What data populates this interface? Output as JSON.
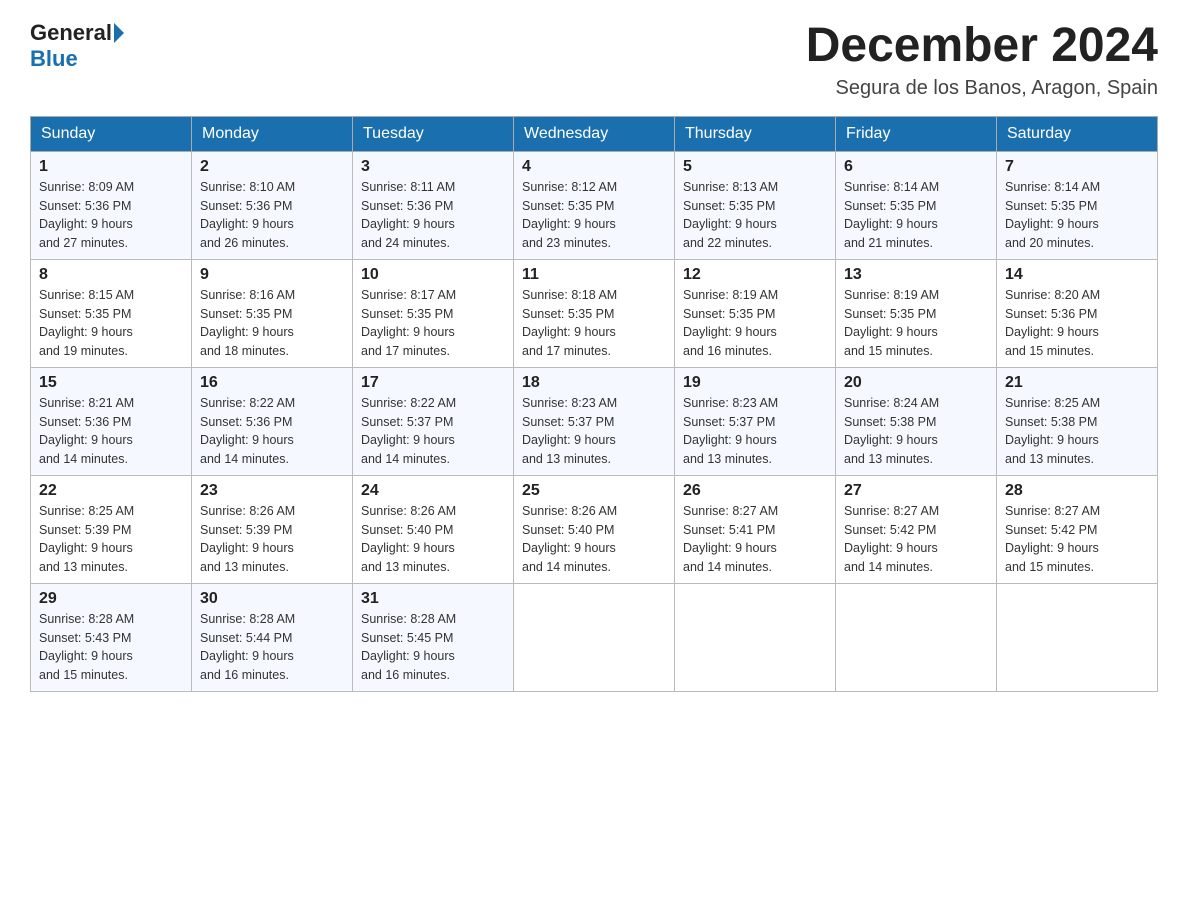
{
  "logo": {
    "text_general": "General",
    "text_blue": "Blue"
  },
  "title": {
    "month": "December 2024",
    "location": "Segura de los Banos, Aragon, Spain"
  },
  "days_of_week": [
    "Sunday",
    "Monday",
    "Tuesday",
    "Wednesday",
    "Thursday",
    "Friday",
    "Saturday"
  ],
  "weeks": [
    [
      {
        "day": "1",
        "sunrise": "8:09 AM",
        "sunset": "5:36 PM",
        "daylight": "9 hours and 27 minutes."
      },
      {
        "day": "2",
        "sunrise": "8:10 AM",
        "sunset": "5:36 PM",
        "daylight": "9 hours and 26 minutes."
      },
      {
        "day": "3",
        "sunrise": "8:11 AM",
        "sunset": "5:36 PM",
        "daylight": "9 hours and 24 minutes."
      },
      {
        "day": "4",
        "sunrise": "8:12 AM",
        "sunset": "5:35 PM",
        "daylight": "9 hours and 23 minutes."
      },
      {
        "day": "5",
        "sunrise": "8:13 AM",
        "sunset": "5:35 PM",
        "daylight": "9 hours and 22 minutes."
      },
      {
        "day": "6",
        "sunrise": "8:14 AM",
        "sunset": "5:35 PM",
        "daylight": "9 hours and 21 minutes."
      },
      {
        "day": "7",
        "sunrise": "8:14 AM",
        "sunset": "5:35 PM",
        "daylight": "9 hours and 20 minutes."
      }
    ],
    [
      {
        "day": "8",
        "sunrise": "8:15 AM",
        "sunset": "5:35 PM",
        "daylight": "9 hours and 19 minutes."
      },
      {
        "day": "9",
        "sunrise": "8:16 AM",
        "sunset": "5:35 PM",
        "daylight": "9 hours and 18 minutes."
      },
      {
        "day": "10",
        "sunrise": "8:17 AM",
        "sunset": "5:35 PM",
        "daylight": "9 hours and 17 minutes."
      },
      {
        "day": "11",
        "sunrise": "8:18 AM",
        "sunset": "5:35 PM",
        "daylight": "9 hours and 17 minutes."
      },
      {
        "day": "12",
        "sunrise": "8:19 AM",
        "sunset": "5:35 PM",
        "daylight": "9 hours and 16 minutes."
      },
      {
        "day": "13",
        "sunrise": "8:19 AM",
        "sunset": "5:35 PM",
        "daylight": "9 hours and 15 minutes."
      },
      {
        "day": "14",
        "sunrise": "8:20 AM",
        "sunset": "5:36 PM",
        "daylight": "9 hours and 15 minutes."
      }
    ],
    [
      {
        "day": "15",
        "sunrise": "8:21 AM",
        "sunset": "5:36 PM",
        "daylight": "9 hours and 14 minutes."
      },
      {
        "day": "16",
        "sunrise": "8:22 AM",
        "sunset": "5:36 PM",
        "daylight": "9 hours and 14 minutes."
      },
      {
        "day": "17",
        "sunrise": "8:22 AM",
        "sunset": "5:37 PM",
        "daylight": "9 hours and 14 minutes."
      },
      {
        "day": "18",
        "sunrise": "8:23 AM",
        "sunset": "5:37 PM",
        "daylight": "9 hours and 13 minutes."
      },
      {
        "day": "19",
        "sunrise": "8:23 AM",
        "sunset": "5:37 PM",
        "daylight": "9 hours and 13 minutes."
      },
      {
        "day": "20",
        "sunrise": "8:24 AM",
        "sunset": "5:38 PM",
        "daylight": "9 hours and 13 minutes."
      },
      {
        "day": "21",
        "sunrise": "8:25 AM",
        "sunset": "5:38 PM",
        "daylight": "9 hours and 13 minutes."
      }
    ],
    [
      {
        "day": "22",
        "sunrise": "8:25 AM",
        "sunset": "5:39 PM",
        "daylight": "9 hours and 13 minutes."
      },
      {
        "day": "23",
        "sunrise": "8:26 AM",
        "sunset": "5:39 PM",
        "daylight": "9 hours and 13 minutes."
      },
      {
        "day": "24",
        "sunrise": "8:26 AM",
        "sunset": "5:40 PM",
        "daylight": "9 hours and 13 minutes."
      },
      {
        "day": "25",
        "sunrise": "8:26 AM",
        "sunset": "5:40 PM",
        "daylight": "9 hours and 14 minutes."
      },
      {
        "day": "26",
        "sunrise": "8:27 AM",
        "sunset": "5:41 PM",
        "daylight": "9 hours and 14 minutes."
      },
      {
        "day": "27",
        "sunrise": "8:27 AM",
        "sunset": "5:42 PM",
        "daylight": "9 hours and 14 minutes."
      },
      {
        "day": "28",
        "sunrise": "8:27 AM",
        "sunset": "5:42 PM",
        "daylight": "9 hours and 15 minutes."
      }
    ],
    [
      {
        "day": "29",
        "sunrise": "8:28 AM",
        "sunset": "5:43 PM",
        "daylight": "9 hours and 15 minutes."
      },
      {
        "day": "30",
        "sunrise": "8:28 AM",
        "sunset": "5:44 PM",
        "daylight": "9 hours and 16 minutes."
      },
      {
        "day": "31",
        "sunrise": "8:28 AM",
        "sunset": "5:45 PM",
        "daylight": "9 hours and 16 minutes."
      },
      null,
      null,
      null,
      null
    ]
  ],
  "labels": {
    "sunrise_prefix": "Sunrise: ",
    "sunset_prefix": "Sunset: ",
    "daylight_prefix": "Daylight: "
  }
}
